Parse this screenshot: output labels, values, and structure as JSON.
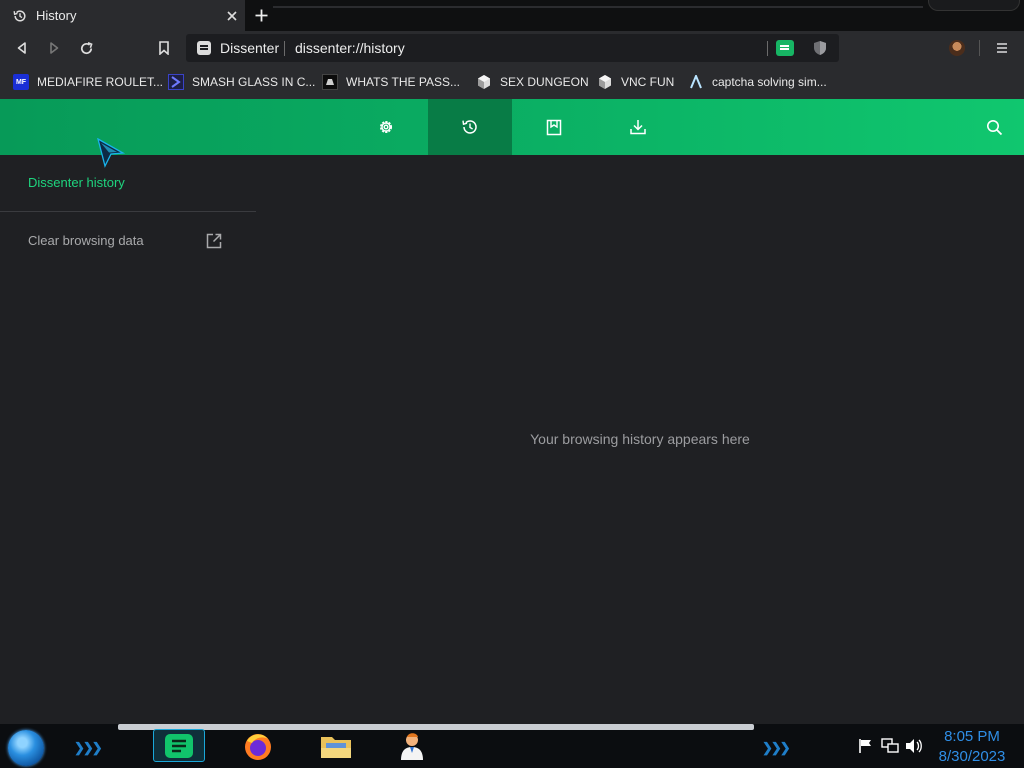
{
  "tab": {
    "title": "History"
  },
  "omnibox": {
    "site_name": "Dissenter",
    "url": "dissenter://history"
  },
  "bookmarks": [
    {
      "label": "MEDIAFIRE ROULET...",
      "icon": "mediafire-icon"
    },
    {
      "label": "SMASH GLASS IN C...",
      "icon": "chevron-bookmark-icon"
    },
    {
      "label": "WHATS THE PASS...",
      "icon": "dark-box-icon"
    },
    {
      "label": "SEX DUNGEON",
      "icon": "cube-icon"
    },
    {
      "label": "VNC FUN",
      "icon": "cube-icon"
    },
    {
      "label": "captcha solving sim...",
      "icon": "lambda-icon"
    }
  ],
  "appbar": {
    "items": [
      {
        "name": "settings",
        "icon": "gear-icon"
      },
      {
        "name": "history",
        "icon": "history-icon",
        "active": true
      },
      {
        "name": "bookmarks",
        "icon": "bookmark-page-icon"
      },
      {
        "name": "downloads",
        "icon": "download-icon"
      }
    ],
    "search_icon": "search-icon"
  },
  "sidebar": {
    "title": "Dissenter history",
    "items": [
      {
        "label": "Clear browsing data",
        "icon": "external-link-icon"
      }
    ]
  },
  "main": {
    "empty_message": "Your browsing history appears here"
  },
  "taskbar": {
    "time": "8:05 PM",
    "date": "8/30/2023"
  },
  "colors": {
    "accent": "#0aac62",
    "accent_active": "#087c46",
    "sidebar_title": "#1ed47e",
    "background": "#1f2023"
  }
}
